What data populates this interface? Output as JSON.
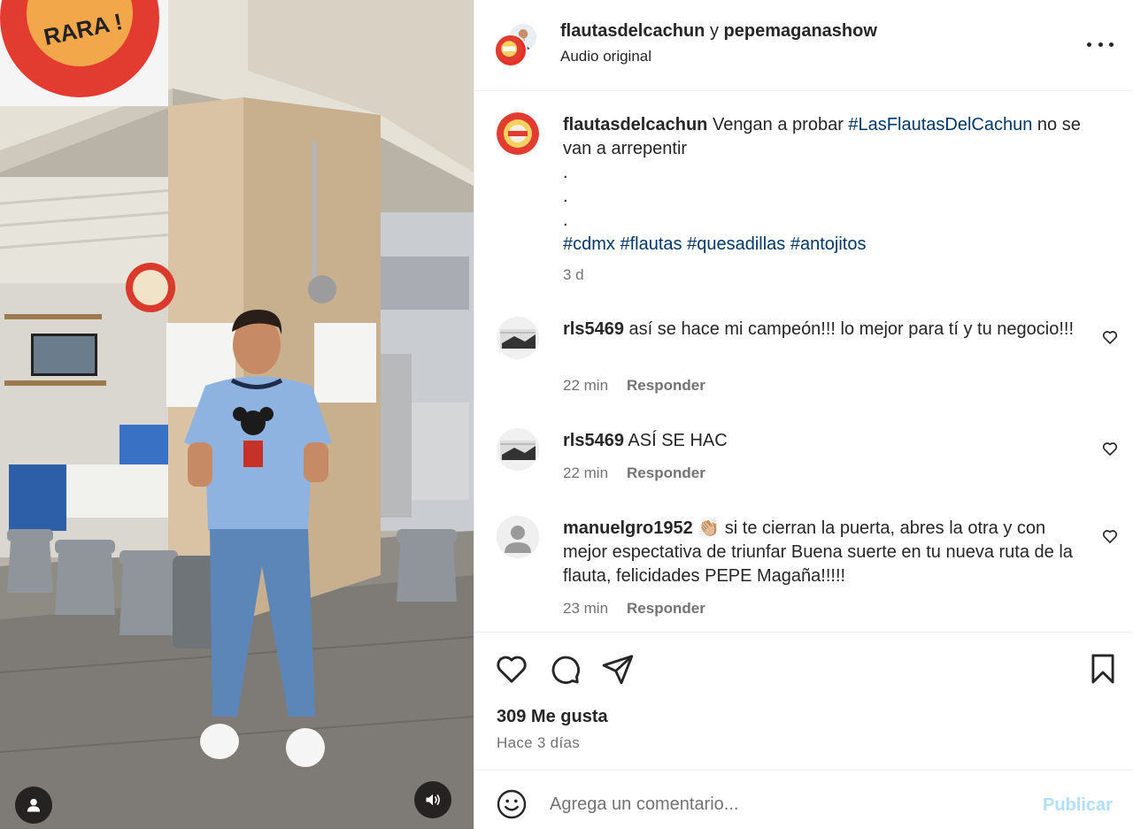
{
  "post": {
    "authors": {
      "primary": "flautasdelcachun",
      "connector": "y",
      "secondary": "pepemaganashow"
    },
    "audio": "Audio original",
    "caption": {
      "username": "flautasdelcachun",
      "text": "Vengan a probar",
      "hashtag_main": "#LasFlautasDelCachun",
      "text_after": "no se van a arrepentir",
      "dots": ".",
      "hashtags": [
        "#cdmx",
        "#flautas",
        "#quesadillas",
        "#antojitos"
      ],
      "time": "3 d"
    },
    "comments": [
      {
        "username": "rls5469",
        "text": "así se hace mi campeón!!! lo mejor para tí y tu negocio!!!",
        "time": "22 min",
        "reply": "Responder"
      },
      {
        "username": "rls5469",
        "text": "ASÍ SE HAC",
        "time": "22 min",
        "reply": "Responder"
      },
      {
        "username": "manuelgro1952",
        "emoji": "👏🏼",
        "text": "si te cierran la puerta, abres la otra y con mejor espectativa de triunfar Buena suerte en tu nueva ruta de la flauta, felicidades PEPE Magaña!!!!!",
        "time": "23 min",
        "reply": "Responder"
      }
    ],
    "likes": "309 Me gusta",
    "posted": "Hace 3 días",
    "composer": {
      "placeholder": "Agrega un comentario...",
      "publish": "Publicar"
    },
    "media_sign_text": "RARA !",
    "icons": {
      "more": "more-options-icon",
      "like": "heart-icon",
      "comment": "comment-icon",
      "share": "share-icon",
      "save": "bookmark-icon",
      "emoji": "emoji-icon",
      "user": "user-icon",
      "audio": "volume-icon"
    },
    "colors": {
      "link": "#00376b",
      "muted": "#737373",
      "publish_disabled": "#b2dffc",
      "text": "#262626"
    }
  }
}
